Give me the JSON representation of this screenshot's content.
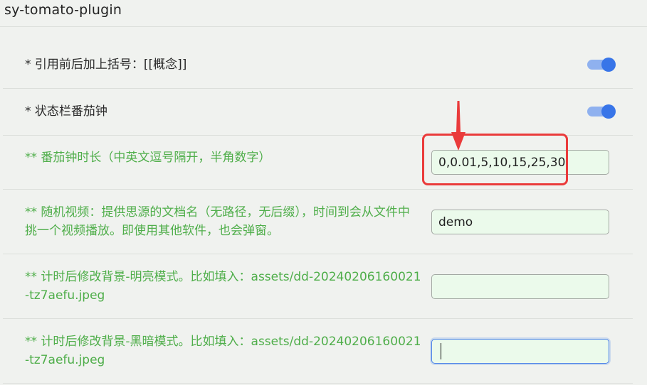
{
  "header": {
    "title": "sy-tomato-plugin"
  },
  "settings": [
    {
      "label": "* 引用前后加上括号：[[概念]]",
      "control": "switch",
      "checked": true
    },
    {
      "label": "* 状态栏番茄钟",
      "control": "switch",
      "checked": true
    },
    {
      "label": "** 番茄钟时长（中英文逗号隔开，半角数字）",
      "control": "text",
      "value": "0,0.01,5,10,15,25,30",
      "placeholder": ""
    },
    {
      "label_line1": "** 随机视频：提供思源的文档名（无路径，无后缀），时间到会从文件中",
      "label_line2": "挑一个视频播放。即使用其他软件，也会弹窗。",
      "control": "text",
      "value": "demo",
      "placeholder": ""
    },
    {
      "label_line1": "** 计时后修改背景-明亮模式。比如填入：assets/dd-20240206160021",
      "label_line2": "-tz7aefu.jpeg",
      "control": "text",
      "value": "",
      "placeholder": ""
    },
    {
      "label_line1": "** 计时后修改背景-黑暗模式。比如填入：assets/dd-20240206160021",
      "label_line2": "-tz7aefu.jpeg",
      "control": "text",
      "value": "",
      "placeholder": "",
      "focused": true
    }
  ],
  "colors": {
    "label_dark": "#2a2a2a",
    "label_green": "#4fae4a",
    "switch_on": "#3875e8",
    "input_bg": "#ebfaeb",
    "annotation": "#ea3b3b"
  }
}
